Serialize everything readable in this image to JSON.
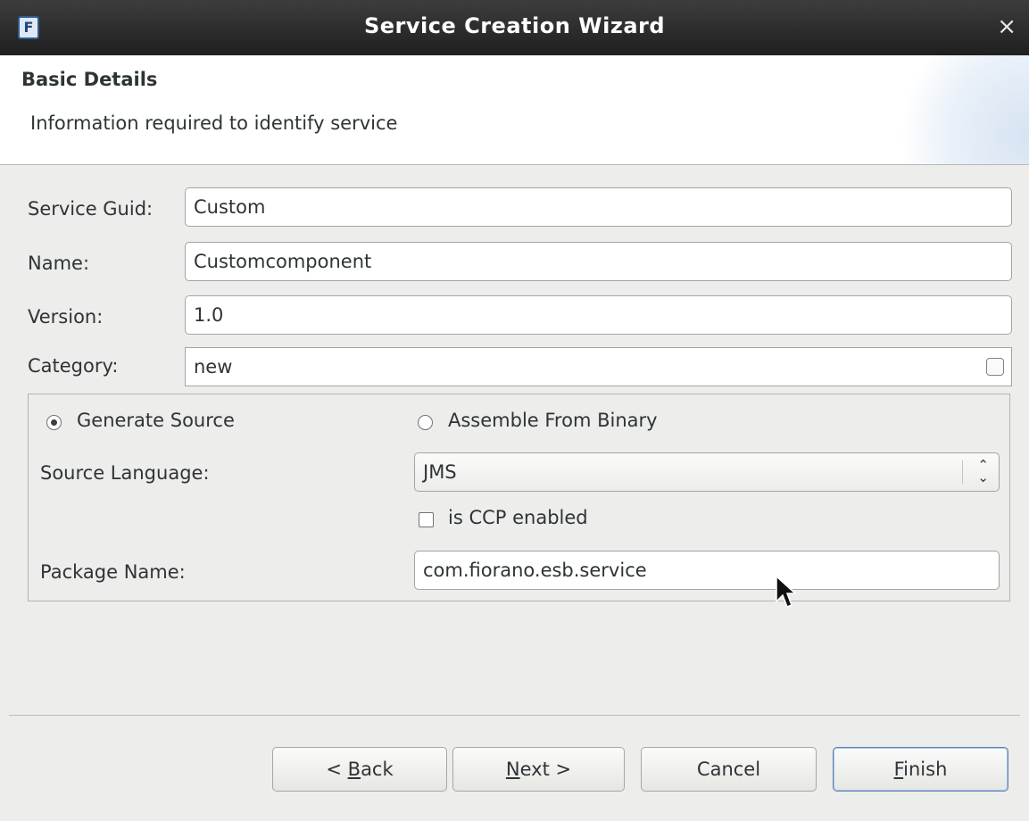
{
  "window": {
    "title": "Service Creation Wizard",
    "icon": "app-icon",
    "icon_glyph": "F",
    "close_glyph": "×"
  },
  "header": {
    "title": "Basic Details",
    "description": "Information required to identify service"
  },
  "fields": {
    "service_guid": {
      "label": "Service Guid:",
      "value": "Custom"
    },
    "name": {
      "label": "Name:",
      "value": "Customcomponent"
    },
    "version": {
      "label": "Version:",
      "value": "1.0"
    },
    "category": {
      "label": "Category:",
      "value": "new"
    }
  },
  "source_group": {
    "generate_source": {
      "label": "Generate Source",
      "selected": true
    },
    "assemble_from_binary": {
      "label": "Assemble From Binary",
      "selected": false
    },
    "source_language": {
      "label": "Source Language:",
      "value": "JMS",
      "toggle_glyph": "⌃⌄"
    },
    "ccp_enabled": {
      "label": "is CCP enabled",
      "checked": false
    },
    "package_name": {
      "label": "Package Name:",
      "value": "com.fiorano.esb.service"
    }
  },
  "buttons": {
    "back": {
      "prefix": "< ",
      "mnemonic": "B",
      "rest": "ack"
    },
    "next": {
      "prefix": "",
      "mnemonic": "N",
      "rest": "ext >"
    },
    "cancel": {
      "label": "Cancel"
    },
    "finish": {
      "prefix": "",
      "mnemonic": "F",
      "rest": "inish"
    }
  },
  "colors": {
    "titlebar": "#2b2b2b",
    "window_bg": "#ededeb",
    "default_button_border": "#5c82b5"
  }
}
